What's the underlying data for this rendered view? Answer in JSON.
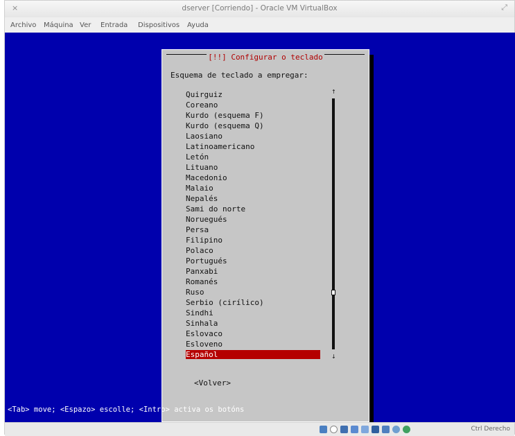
{
  "window": {
    "title": "dserver [Corriendo] - Oracle VM VirtualBox",
    "close_glyph": "×",
    "restore_glyph": "⤢"
  },
  "menu": {
    "items": [
      "Archivo",
      "Máquina",
      "Ver",
      "Entrada",
      "Dispositivos",
      "Ayuda"
    ]
  },
  "installer": {
    "dialog_title": "[!!] Configurar o teclado",
    "prompt": "Esquema de teclado a empregar:",
    "layouts": [
      "Quirguiz",
      "Coreano",
      "Kurdo (esquema F)",
      "Kurdo (esquema Q)",
      "Laosiano",
      "Latinoamericano",
      "Letón",
      "Lituano",
      "Macedonio",
      "Malaio",
      "Nepalés",
      "Sami do norte",
      "Noruegués",
      "Persa",
      "Filipino",
      "Polaco",
      "Portugués",
      "Panxabi",
      "Romanés",
      "Ruso",
      "Serbio (cirílico)",
      "Sindhi",
      "Sinhala",
      "Eslovaco",
      "Esloveno",
      "Español"
    ],
    "selected_layout": "Español",
    "back_button": "<Volver>",
    "help_line": "<Tab> move; <Espazo> escolle; <Intro> activa os botóns",
    "scroll_glyph_up": "↑",
    "scroll_glyph_down": "↓"
  },
  "statusbar": {
    "host_key_label": "Ctrl Derecho",
    "icons": [
      "hard-disk-icon",
      "optical-drive-icon",
      "network-icon",
      "usb-icon",
      "shared-folder-icon",
      "display-icon",
      "video-capture-icon",
      "mouse-integration-icon",
      "keyboard-capture-icon"
    ]
  },
  "colors": {
    "vm_background": "#0000ad",
    "dialog_background": "#c6c6c6",
    "dialog_title": "#b00000",
    "selection": "#b50000"
  }
}
